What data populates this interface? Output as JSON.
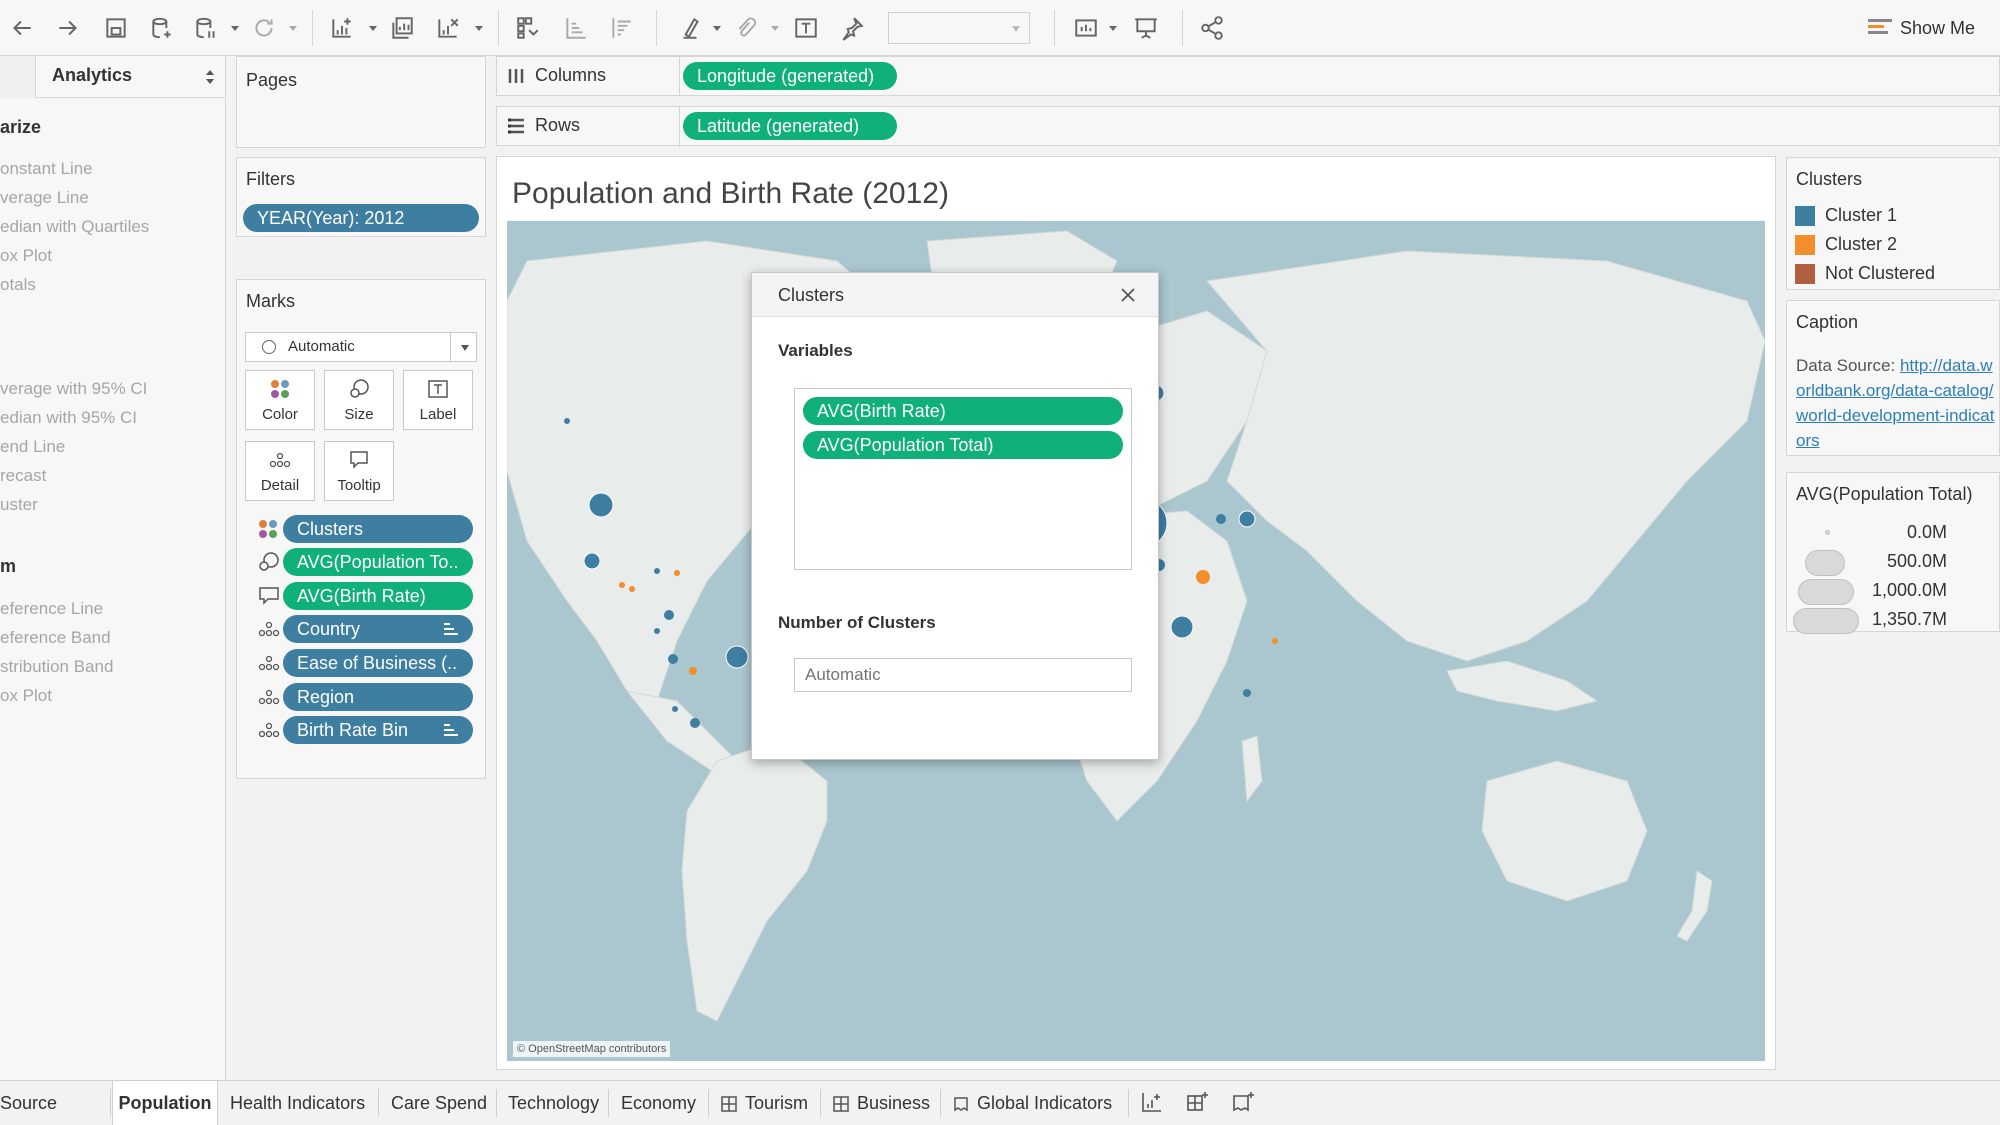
{
  "toolbar": {
    "show_me_label": "Show Me",
    "icons": [
      "back-icon",
      "forward-icon",
      "save-icon",
      "new-datasource-icon",
      "pause-icon",
      "refresh-icon",
      "new-worksheet-icon",
      "duplicate-icon",
      "clear-icon",
      "swap-icon",
      "sort-asc-icon",
      "sort-desc-icon",
      "highlight-icon",
      "group-icon",
      "labels-icon",
      "pin-icon",
      "fit-icon",
      "presentation-icon",
      "share-icon"
    ]
  },
  "analytics": {
    "tab_label": "Analytics",
    "summarize_heading": "arize",
    "summarize_items": [
      "onstant Line",
      "verage Line",
      "edian with Quartiles",
      "ox Plot",
      "otals"
    ],
    "model_items": [
      "verage with 95% CI",
      "edian with 95% CI",
      "end Line",
      "recast",
      "uster"
    ],
    "custom_heading": "m",
    "custom_items": [
      "eference Line",
      "eference Band",
      "stribution Band",
      "ox Plot"
    ]
  },
  "pages": {
    "title": "Pages"
  },
  "filters": {
    "title": "Filters",
    "pill": "YEAR(Year): 2012"
  },
  "marks": {
    "title": "Marks",
    "type": "Automatic",
    "buttons": {
      "color": "Color",
      "size": "Size",
      "label": "Label",
      "detail": "Detail",
      "tooltip": "Tooltip"
    },
    "fields": [
      {
        "label": "Clusters",
        "style": "blue",
        "icon": "color-icon"
      },
      {
        "label": "AVG(Population To..",
        "style": "green",
        "icon": "size-icon"
      },
      {
        "label": "AVG(Birth Rate)",
        "style": "green",
        "icon": "tooltip-icon"
      },
      {
        "label": "Country",
        "style": "blue",
        "icon": "detail-icon"
      },
      {
        "label": "Ease of Business (..",
        "style": "blue",
        "icon": "detail-icon"
      },
      {
        "label": "Region",
        "style": "blue",
        "icon": "detail-icon"
      },
      {
        "label": "Birth Rate Bin",
        "style": "blue",
        "icon": "detail-icon"
      }
    ]
  },
  "shelves": {
    "columns_label": "Columns",
    "columns_pill": "Longitude (generated)",
    "rows_label": "Rows",
    "rows_pill": "Latitude (generated)"
  },
  "view": {
    "title": "Population and Birth Rate (2012)",
    "map_credit": "© OpenStreetMap contributors"
  },
  "dialog": {
    "title": "Clusters",
    "variables_label": "Variables",
    "variables": [
      "AVG(Birth Rate)",
      "AVG(Population Total)"
    ],
    "num_clusters_label": "Number of Clusters",
    "num_clusters_placeholder": "Automatic"
  },
  "legends": {
    "clusters_title": "Clusters",
    "clusters": [
      {
        "label": "Cluster 1",
        "color": "#3e7ea0"
      },
      {
        "label": "Cluster 2",
        "color": "#f28e2b"
      },
      {
        "label": "Not Clustered",
        "color": "#b0603f"
      }
    ],
    "caption_title": "Caption",
    "caption_prefix": "Data Source: ",
    "caption_link": "http://data.worldbank.org/data-catalog/world-development-indicators",
    "size_title": "AVG(Population Total)",
    "sizes": [
      "0.0M",
      "500.0M",
      "1,000.0M",
      "1,350.7M"
    ]
  },
  "tabs": {
    "items": [
      "Source",
      "Population",
      "Health Indicators",
      "Care Spend",
      "Technology",
      "Economy",
      "Tourism",
      "Business",
      "Global Indicators"
    ],
    "active": "Population"
  },
  "colors": {
    "cluster1": "#3e7ea0",
    "cluster2": "#f28e2b",
    "green_pill": "#10b07a",
    "blue_pill": "#3e7ea0"
  }
}
